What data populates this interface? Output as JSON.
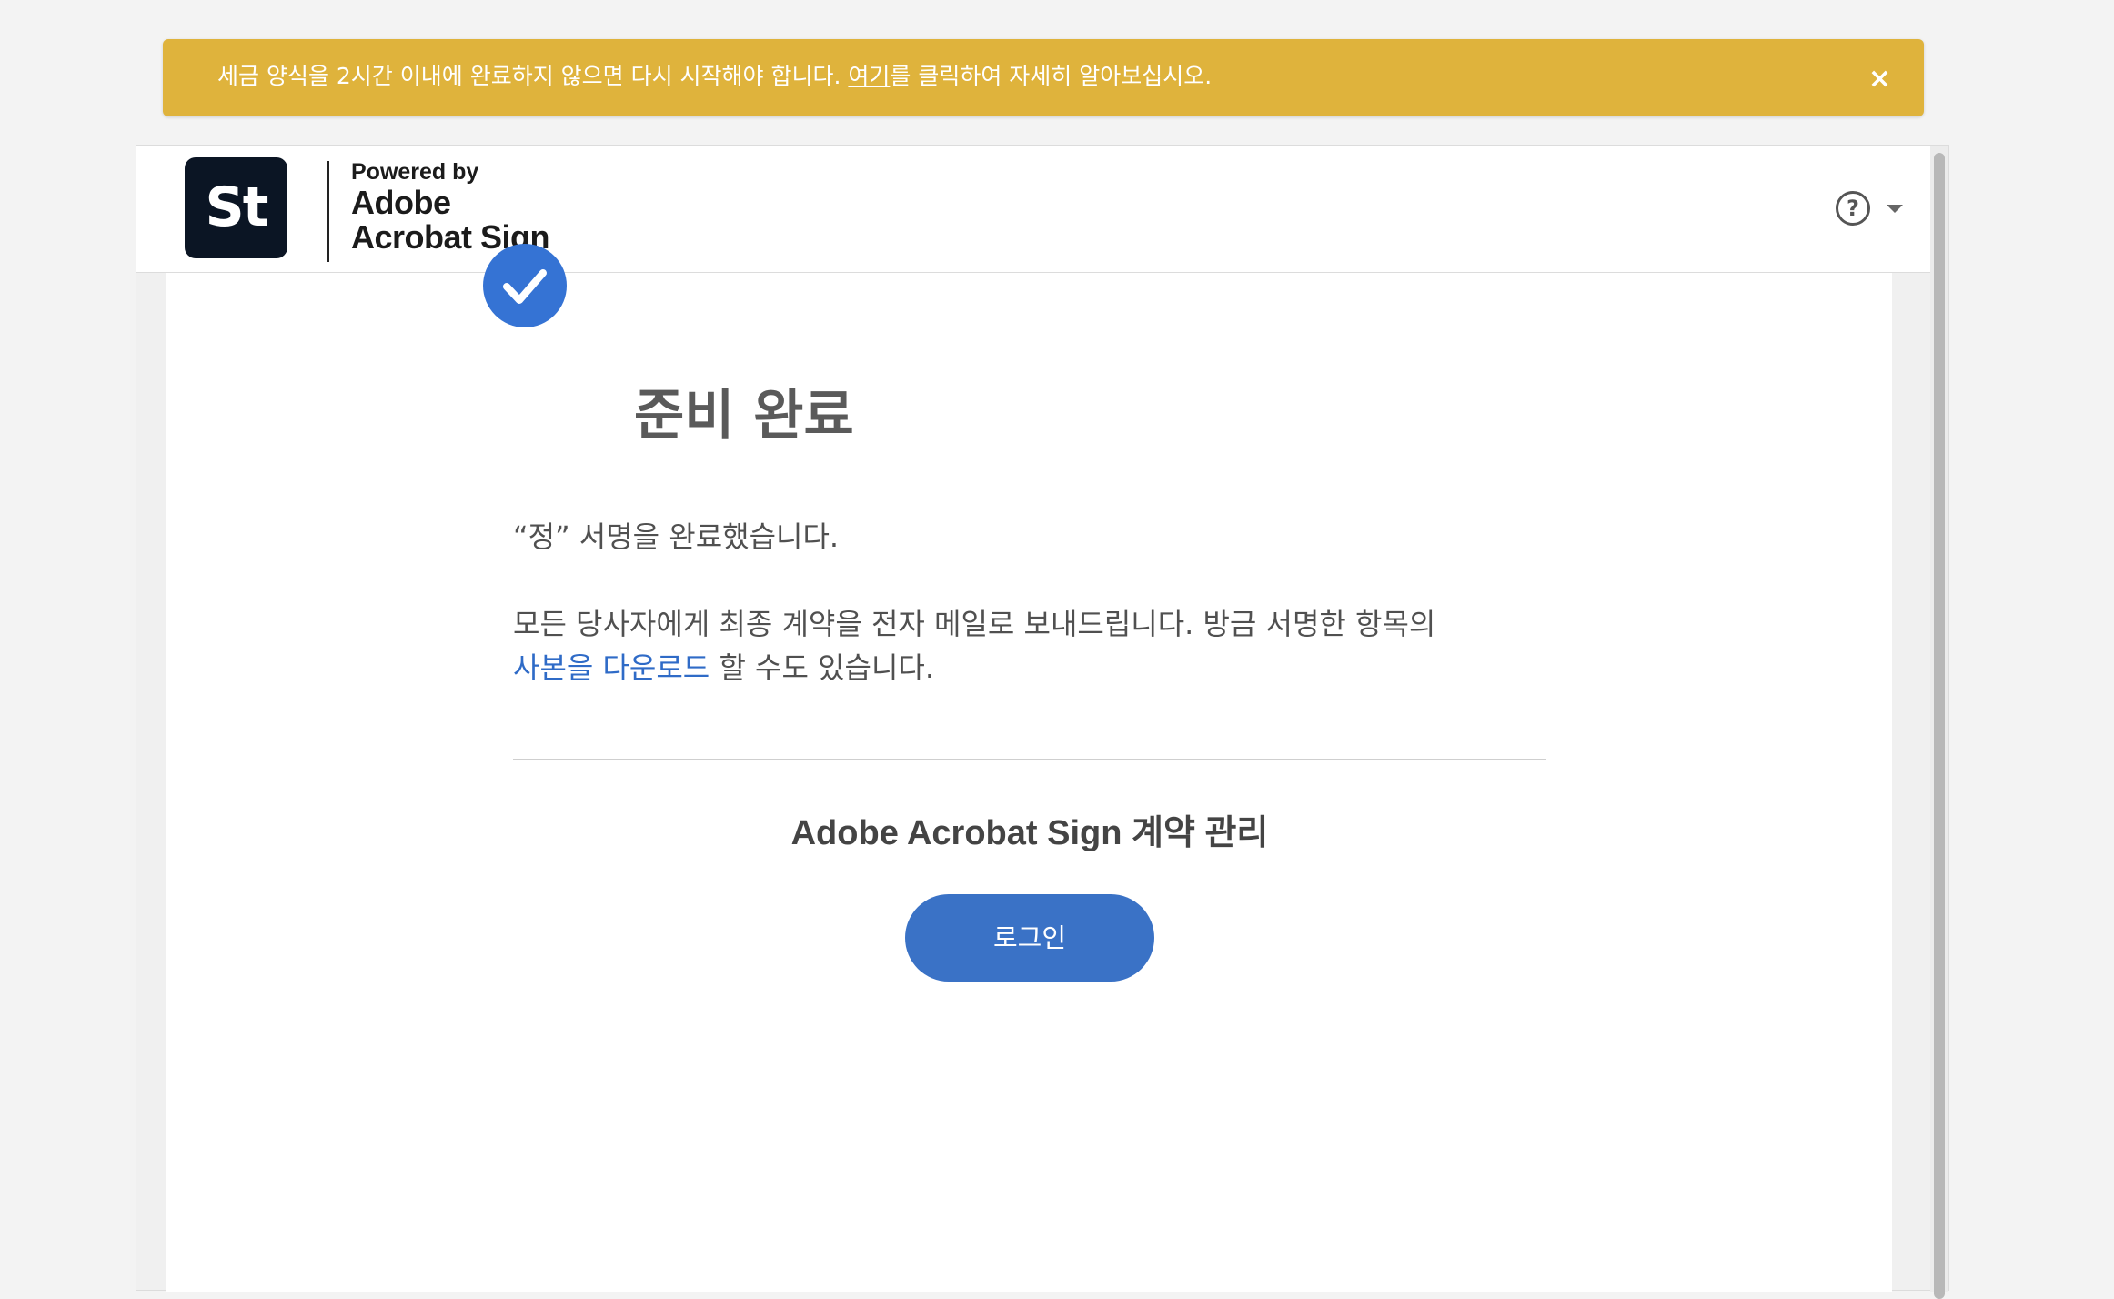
{
  "banner": {
    "text_before": "세금 양식을 2시간 이내에 완료하지 않으면 다시 시작해야 합니다. ",
    "link": "여기",
    "text_after": "를 클릭하여 자세히 알아보십시오.",
    "close": "×",
    "color": "#dfb33c"
  },
  "header": {
    "logo_text": "St",
    "powered_by": "Powered by",
    "brand_line1": "Adobe",
    "brand_line2": "Acrobat Sign",
    "help_icon": "?",
    "help_menu_icon": "chevron-down-icon"
  },
  "main": {
    "title": "준비 완료",
    "signed_text": "“정” 서명을 완료했습니다.",
    "info_before": "모든 당사자에게 최종 계약을 전자 메일로 보내드립니다. 방금 서명한 항목의",
    "download_link": "사본을 다운로드",
    "info_after": " 할 수도 있습니다.",
    "manage_heading": "Adobe Acrobat Sign 계약 관리",
    "login_button": "로그인",
    "accent_color": "#3573d4"
  }
}
